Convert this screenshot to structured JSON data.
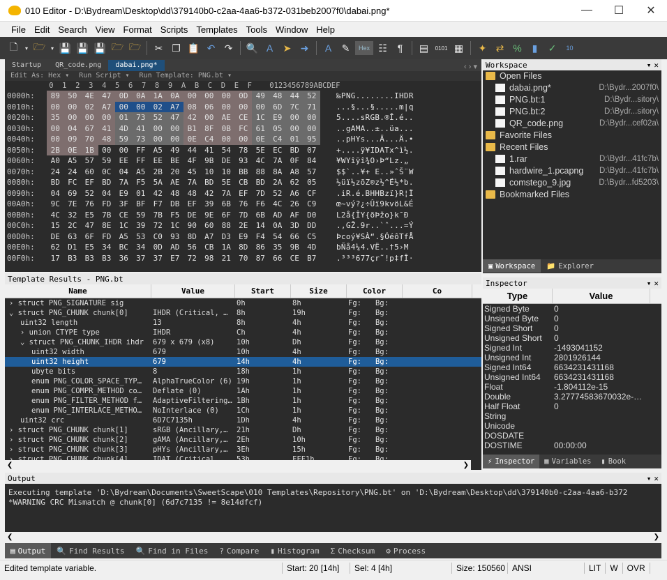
{
  "window": {
    "title": "010 Editor - D:\\Bydream\\Desktop\\dd\\379140b0-c2aa-4aa6-b372-031beb2007f0\\dabai.png*"
  },
  "menu": [
    "File",
    "Edit",
    "Search",
    "View",
    "Format",
    "Scripts",
    "Templates",
    "Tools",
    "Window",
    "Help"
  ],
  "file_tabs": [
    {
      "label": "Startup",
      "active": false
    },
    {
      "label": "QR_code.png",
      "active": false
    },
    {
      "label": "dabai.png*",
      "active": true
    }
  ],
  "edit_bar": {
    "edit_as": "Edit As: Hex ▾",
    "run_script": "Run Script ▾",
    "run_template": "Run Template: PNG.bt ▾"
  },
  "hex_header": "          0  1  2  3  4  5  6  7  8  9  A  B  C  D  E  F    0123456789ABCDEF",
  "hex_rows": [
    {
      "off": "0000h:",
      "bytes": [
        "89",
        "50",
        "4E",
        "47",
        "0D",
        "0A",
        "1A",
        "0A",
        "00",
        "00",
        "00",
        "0D",
        "49",
        "48",
        "44",
        "52"
      ],
      "ascii": "‰PNG........IHDR"
    },
    {
      "off": "0010h:",
      "bytes": [
        "00",
        "00",
        "02",
        "A7",
        "00",
        "00",
        "02",
        "A7",
        "08",
        "06",
        "00",
        "00",
        "00",
        "6D",
        "7C",
        "71"
      ],
      "ascii": "...§...§.....m|q"
    },
    {
      "off": "0020h:",
      "bytes": [
        "35",
        "00",
        "00",
        "00",
        "01",
        "73",
        "52",
        "47",
        "42",
        "00",
        "AE",
        "CE",
        "1C",
        "E9",
        "00",
        "00"
      ],
      "ascii": "5....sRGB.®Î.é.."
    },
    {
      "off": "0030h:",
      "bytes": [
        "00",
        "04",
        "67",
        "41",
        "4D",
        "41",
        "00",
        "00",
        "B1",
        "8F",
        "0B",
        "FC",
        "61",
        "05",
        "00",
        "00"
      ],
      "ascii": "..gAMA..±..üa..."
    },
    {
      "off": "0040h:",
      "bytes": [
        "00",
        "09",
        "70",
        "48",
        "59",
        "73",
        "00",
        "00",
        "0E",
        "C4",
        "00",
        "00",
        "0E",
        "C4",
        "01",
        "95"
      ],
      "ascii": "..pHYs...Ä...Ä.•"
    },
    {
      "off": "0050h:",
      "bytes": [
        "2B",
        "0E",
        "1B",
        "00",
        "00",
        "FF",
        "A5",
        "49",
        "44",
        "41",
        "54",
        "78",
        "5E",
        "EC",
        "BD",
        "07"
      ],
      "ascii": "+....ÿ¥IDATx^ì½."
    },
    {
      "off": "0060h:",
      "bytes": [
        "A0",
        "A5",
        "57",
        "59",
        "EE",
        "FF",
        "EE",
        "BE",
        "4F",
        "9B",
        "DE",
        "93",
        "4C",
        "7A",
        "0F",
        "84"
      ],
      "ascii": " ¥WYîÿî¾O›Þ“Lz.„"
    },
    {
      "off": "0070h:",
      "bytes": [
        "24",
        "24",
        "60",
        "0C",
        "04",
        "A5",
        "2B",
        "20",
        "45",
        "10",
        "10",
        "BB",
        "88",
        "8A",
        "A8",
        "57"
      ],
      "ascii": "$$`..¥+ E..»ˆŠ¨W"
    },
    {
      "off": "0080h:",
      "bytes": [
        "BD",
        "FC",
        "EF",
        "BD",
        "7A",
        "F5",
        "5A",
        "AE",
        "7A",
        "BD",
        "5E",
        "CB",
        "BD",
        "2A",
        "62",
        "05"
      ],
      "ascii": "½üï½zõZ®z½^Ë½*b."
    },
    {
      "off": "0090h:",
      "bytes": [
        "04",
        "69",
        "52",
        "04",
        "E9",
        "01",
        "42",
        "48",
        "48",
        "42",
        "7A",
        "EF",
        "7D",
        "52",
        "A6",
        "CF"
      ],
      "ascii": ".iR.é.BHHBzï}R¦Ï"
    },
    {
      "off": "00A0h:",
      "bytes": [
        "9C",
        "7E",
        "76",
        "FD",
        "3F",
        "BF",
        "F7",
        "DB",
        "EF",
        "39",
        "6B",
        "76",
        "F6",
        "4C",
        "26",
        "C9"
      ],
      "ascii": "œ~vý?¿÷Ûï9kvöL&É"
    },
    {
      "off": "00B0h:",
      "bytes": [
        "4C",
        "32",
        "E5",
        "7B",
        "CE",
        "59",
        "7B",
        "F5",
        "DE",
        "9E",
        "6F",
        "7D",
        "6B",
        "AD",
        "AF",
        "D0"
      ],
      "ascii": "L2å{ÎY{õÞžo}k­¯Ð"
    },
    {
      "off": "00C0h:",
      "bytes": [
        "15",
        "2C",
        "47",
        "8E",
        "1C",
        "39",
        "72",
        "1C",
        "90",
        "60",
        "88",
        "2E",
        "14",
        "0A",
        "3D",
        "DD"
      ],
      "ascii": ".,GŽ.9r..`ˆ...=Ý"
    },
    {
      "off": "00D0h:",
      "bytes": [
        "DE",
        "63",
        "6F",
        "FD",
        "A5",
        "53",
        "C0",
        "93",
        "8D",
        "A7",
        "D3",
        "E9",
        "F4",
        "54",
        "66",
        "C5"
      ],
      "ascii": "Þcoý¥SÀ“.§ÓéôTfÅ"
    },
    {
      "off": "00E0h:",
      "bytes": [
        "62",
        "D1",
        "E5",
        "34",
        "BC",
        "34",
        "0D",
        "AD",
        "56",
        "CB",
        "1A",
        "8D",
        "86",
        "35",
        "9B",
        "4D"
      ],
      "ascii": "bÑå4¼4.­VË..†5›M"
    },
    {
      "off": "00F0h:",
      "bytes": [
        "17",
        "B3",
        "B3",
        "B3",
        "36",
        "37",
        "37",
        "E7",
        "72",
        "98",
        "21",
        "70",
        "87",
        "66",
        "CE",
        "B7"
      ],
      "ascii": ".³³³677çr˜!p‡fÎ·"
    }
  ],
  "workspace": {
    "title": "Workspace",
    "items": [
      {
        "label": "Open Files",
        "type": "folder",
        "indent": 0,
        "path": ""
      },
      {
        "label": "dabai.png*",
        "type": "file",
        "indent": 1,
        "path": "D:\\Bydr...2007f0\\"
      },
      {
        "label": "PNG.bt:1",
        "type": "file",
        "indent": 1,
        "path": "D:\\Bydr...sitory\\"
      },
      {
        "label": "PNG.bt:2",
        "type": "file",
        "indent": 1,
        "path": "D:\\Bydr...sitory\\"
      },
      {
        "label": "QR_code.png",
        "type": "file",
        "indent": 1,
        "path": "D:\\Bydr...cef02a\\"
      },
      {
        "label": "Favorite Files",
        "type": "folder",
        "indent": 0,
        "path": ""
      },
      {
        "label": "Recent Files",
        "type": "folder",
        "indent": 0,
        "path": ""
      },
      {
        "label": "1.rar",
        "type": "file",
        "indent": 1,
        "path": "D:\\Bydr...41fc7b\\"
      },
      {
        "label": "hardwire_1.pcapng",
        "type": "file",
        "indent": 1,
        "path": "D:\\Bydr...41fc7b\\"
      },
      {
        "label": "comstego_9.jpg",
        "type": "file",
        "indent": 1,
        "path": "D:\\Bydr...fd5203\\"
      },
      {
        "label": "Bookmarked Files",
        "type": "folder",
        "indent": 0,
        "path": ""
      }
    ],
    "tabs": [
      "Workspace",
      "Explorer"
    ]
  },
  "template": {
    "title": "Template Results - PNG.bt",
    "columns": [
      "Name",
      "Value",
      "Start",
      "Size",
      "Color",
      "Co"
    ],
    "rows": [
      {
        "name": "› struct PNG_SIGNATURE sig",
        "indent": 0,
        "value": "",
        "start": "0h",
        "size": "8h",
        "fg": "Fg:",
        "bg": "Bg:",
        "swatch": "#f4c6e8",
        "sel": false
      },
      {
        "name": "⌄ struct PNG_CHUNK chunk[0]",
        "indent": 0,
        "value": "IHDR  (Critical, …",
        "start": "8h",
        "size": "19h",
        "fg": "Fg:",
        "bg": "Bg:",
        "swatch": "",
        "sel": false
      },
      {
        "name": "uint32 length",
        "indent": 2,
        "value": "13",
        "start": "8h",
        "size": "4h",
        "fg": "Fg:",
        "bg": "Bg:",
        "swatch": "#e0e0e0",
        "sel": false
      },
      {
        "name": "› union CTYPE type",
        "indent": 2,
        "value": "IHDR",
        "start": "Ch",
        "size": "4h",
        "fg": "Fg:",
        "bg": "Bg:",
        "swatch": "#e0e0e0",
        "sel": false
      },
      {
        "name": "⌄ struct PNG_CHUNK_IHDR ihdr",
        "indent": 2,
        "value": "679 x 679 (x8)",
        "start": "10h",
        "size": "Dh",
        "fg": "Fg:",
        "bg": "Bg:",
        "swatch": "",
        "sel": false
      },
      {
        "name": "uint32 width",
        "indent": 4,
        "value": "679",
        "start": "10h",
        "size": "4h",
        "fg": "Fg:",
        "bg": "Bg:",
        "swatch": "",
        "sel": false
      },
      {
        "name": "uint32 height",
        "indent": 4,
        "value": "679",
        "start": "14h",
        "size": "4h",
        "fg": "Fg:",
        "bg": "Bg:",
        "swatch": "",
        "sel": true
      },
      {
        "name": "ubyte bits",
        "indent": 4,
        "value": "8",
        "start": "18h",
        "size": "1h",
        "fg": "Fg:",
        "bg": "Bg:",
        "swatch": "",
        "sel": false
      },
      {
        "name": "enum PNG_COLOR_SPACE_TYP…",
        "indent": 4,
        "value": "AlphaTrueColor (6)",
        "start": "19h",
        "size": "1h",
        "fg": "Fg:",
        "bg": "Bg:",
        "swatch": "",
        "sel": false
      },
      {
        "name": "enum PNG_COMPR_METHOD co…",
        "indent": 4,
        "value": "Deflate (0)",
        "start": "1Ah",
        "size": "1h",
        "fg": "Fg:",
        "bg": "Bg:",
        "swatch": "",
        "sel": false
      },
      {
        "name": "enum PNG_FILTER_METHOD f…",
        "indent": 4,
        "value": "AdaptiveFiltering…",
        "start": "1Bh",
        "size": "1h",
        "fg": "Fg:",
        "bg": "Bg:",
        "swatch": "",
        "sel": false
      },
      {
        "name": "enum PNG_INTERLACE_METHO…",
        "indent": 4,
        "value": "NoInterlace (0)",
        "start": "1Ch",
        "size": "1h",
        "fg": "Fg:",
        "bg": "Bg:",
        "swatch": "",
        "sel": false
      },
      {
        "name": "uint32 crc",
        "indent": 2,
        "value": "6D7C7135h",
        "start": "1Dh",
        "size": "4h",
        "fg": "Fg:",
        "bg": "Bg:",
        "swatch": "",
        "sel": false
      },
      {
        "name": "› struct PNG_CHUNK chunk[1]",
        "indent": 0,
        "value": "sRGB  (Ancillary,…",
        "start": "21h",
        "size": "Dh",
        "fg": "Fg:",
        "bg": "Bg:",
        "swatch": "",
        "sel": false
      },
      {
        "name": "› struct PNG_CHUNK chunk[2]",
        "indent": 0,
        "value": "gAMA  (Ancillary,…",
        "start": "2Eh",
        "size": "10h",
        "fg": "Fg:",
        "bg": "Bg:",
        "swatch": "",
        "sel": false
      },
      {
        "name": "› struct PNG_CHUNK chunk[3]",
        "indent": 0,
        "value": "pHYs  (Ancillary,…",
        "start": "3Eh",
        "size": "15h",
        "fg": "Fg:",
        "bg": "Bg:",
        "swatch": "",
        "sel": false
      },
      {
        "name": "› struct PNG_CHUNK chunk[4]",
        "indent": 0,
        "value": "IDAT  (Critical, …",
        "start": "53h",
        "size": "FFF1h",
        "fg": "Fg:",
        "bg": "Bg:",
        "swatch": "",
        "sel": false
      }
    ]
  },
  "inspector": {
    "title": "Inspector",
    "columns": [
      "Type",
      "Value"
    ],
    "rows": [
      {
        "k": "Signed Byte",
        "v": "0"
      },
      {
        "k": "Unsigned Byte",
        "v": "0"
      },
      {
        "k": "Signed Short",
        "v": "0"
      },
      {
        "k": "Unsigned Short",
        "v": "0"
      },
      {
        "k": "Signed Int",
        "v": "-1493041152"
      },
      {
        "k": "Unsigned Int",
        "v": "2801926144"
      },
      {
        "k": "Signed Int64",
        "v": "6634231431168"
      },
      {
        "k": "Unsigned Int64",
        "v": "6634231431168"
      },
      {
        "k": "Float",
        "v": "-1.804112e-15"
      },
      {
        "k": "Double",
        "v": "3.27774583670032e-…"
      },
      {
        "k": "Half Float",
        "v": "0"
      },
      {
        "k": "String",
        "v": ""
      },
      {
        "k": "Unicode",
        "v": ""
      },
      {
        "k": "DOSDATE",
        "v": ""
      },
      {
        "k": "DOSTIME",
        "v": "00:00:00"
      }
    ],
    "tabs": [
      "Inspector",
      "Variables",
      "Book"
    ]
  },
  "output": {
    "title": "Output",
    "lines": [
      "Executing template 'D:\\Bydream\\Documents\\SweetScape\\010 Templates\\Repository\\PNG.bt' on 'D:\\Bydream\\Desktop\\dd\\379140b0-c2aa-4aa6-b372",
      "*WARNING CRC Mismatch @ chunk[0] (6d7c7135 != 8e14dfcf)"
    ],
    "tabs": [
      "Output",
      "Find Results",
      "Find in Files",
      "Compare",
      "Histogram",
      "Checksum",
      "Process"
    ]
  },
  "status": {
    "message": "Edited template variable.",
    "start": "Start: 20 [14h]",
    "sel": "Sel: 4 [4h]",
    "size": "Size: 150560",
    "encoding": "ANSI",
    "lit": "LIT",
    "w": "W",
    "ovr": "OVR"
  }
}
